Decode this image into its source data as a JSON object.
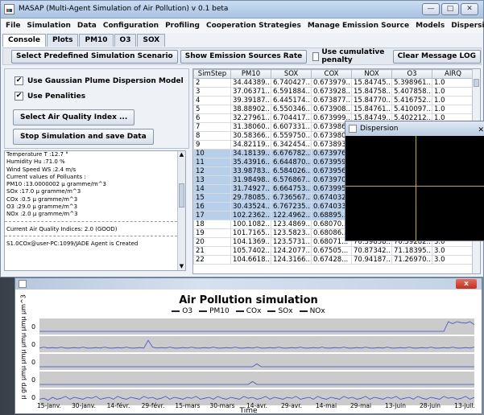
{
  "window": {
    "title": "MASAP (Multi-Agent Simulation of Air Pollution) v 0.1 beta",
    "controls": {
      "minimize": "—",
      "maximize": "□",
      "close": "✕"
    }
  },
  "menu": [
    "File",
    "Simulation",
    "Data",
    "Configuration",
    "Profiling",
    "Cooperation Strategies",
    "Manage Emission Source",
    "Models",
    "Dispersion",
    "?"
  ],
  "tabs": [
    "Console",
    "Plots",
    "PM10",
    "O3",
    "SOX"
  ],
  "toolbar": {
    "scenario_btn": "Select Predefined Simulation Scenario",
    "emission_btn": "Show Emission Sources Rate",
    "cumulative_label": "Use cumulative penalty",
    "clear_btn": "Clear Message LOG"
  },
  "left_panel": {
    "gaussian_label": "Use Gaussian Plume Dispersion Model",
    "penalties_label": "Use Penalities",
    "air_quality_btn": "Select Air Quality Index ...",
    "stop_btn": "Stop Simulation and save Data"
  },
  "log": [
    "            Temperature T   :12.7 °",
    "            Humidity Hu    :71.0 %",
    "            Wind Speed WS   :2.4 m/s",
    "Current values of Polluants :",
    "       PM10  :13.0000002  µ gramme/m^3",
    "       SOx   :17.0  µ gramme/m^3",
    "       COx   :0.5  µ gramme/m^3",
    "       O3    :29.0  µ gramme/m^3",
    "       NOx   :2.0  µ gramme/m^3",
    "",
    "Current Air Quality Indices: 2.0 (GOOD)",
    "",
    "S1.0COx@user-PC:1099/JADE Agent is Created"
  ],
  "table": {
    "headers": [
      "SimStep",
      "PM10",
      "SOX",
      "COX",
      "NOX",
      "O3",
      "AIRQ"
    ],
    "rows": [
      [
        "2",
        "34.44389...",
        "6.740427...",
        "0.673979...",
        "15.84745...",
        "5.398961...",
        "1.0"
      ],
      [
        "3",
        "37.06371...",
        "6.591884...",
        "0.673928...",
        "15.84758...",
        "5.407858...",
        "1.0"
      ],
      [
        "4",
        "39.39187...",
        "6.445174...",
        "0.673877...",
        "15.84770...",
        "5.416752...",
        "1.0"
      ],
      [
        "5",
        "38.88902...",
        "6.550346...",
        "0.673908...",
        "15.84761...",
        "5.410097...",
        "1.0"
      ],
      [
        "6",
        "32.27961...",
        "6.704417...",
        "0.673999...",
        "15.84749...",
        "5.402212...",
        "1.0"
      ],
      [
        "7",
        "31.38060...",
        "6.607331...",
        "0.673986...",
        "",
        "",
        ""
      ],
      [
        "8",
        "30.58366...",
        "6.559750...",
        "0.673980...",
        "",
        "",
        ""
      ],
      [
        "9",
        "34.82119...",
        "6.342454...",
        "0.673893...",
        "",
        "",
        ""
      ],
      [
        "10",
        "34.18139...",
        "6.676782...",
        "0.673976...",
        "",
        "",
        ""
      ],
      [
        "11",
        "35.43916...",
        "6.644870...",
        "0.673959...",
        "",
        "",
        ""
      ],
      [
        "12",
        "33.98783...",
        "6.584026...",
        "0.673956...",
        "",
        "",
        ""
      ],
      [
        "13",
        "31.98498...",
        "6.576867...",
        "0.673970...",
        "",
        "",
        ""
      ],
      [
        "14",
        "31.74927...",
        "6.664753...",
        "0.673995...",
        "",
        "",
        ""
      ],
      [
        "15",
        "29.78085...",
        "6.736567...",
        "0.674032...",
        "",
        "",
        ""
      ],
      [
        "16",
        "30.43524...",
        "6.767235...",
        "0.674033...",
        "",
        "",
        ""
      ],
      [
        "17",
        "102.2362...",
        "122.4962...",
        "0.68895...",
        "",
        "",
        ""
      ],
      [
        "18",
        "100.1082...",
        "123.4869...",
        "0.68070...",
        "",
        "",
        ""
      ],
      [
        "19",
        "101.7165...",
        "123.5823...",
        "0.68086...",
        "",
        "",
        ""
      ],
      [
        "20",
        "104.1369...",
        "123.5731...",
        "0.68071...",
        "70.39858...",
        "70.59282...",
        "3.0"
      ],
      [
        "21",
        "105.7402...",
        "124.2077...",
        "0.67505...",
        "70.87342...",
        "71.18395...",
        "3.0"
      ],
      [
        "22",
        "104.6618...",
        "124.3166...",
        "0.67428...",
        "70.94187...",
        "71.26970...",
        "3.0"
      ]
    ]
  },
  "dispersion": {
    "title": "Dispersion",
    "close": "✕"
  },
  "chart_window": {
    "close": "x"
  },
  "chart_data": {
    "type": "line",
    "title": "Air Pollution simulation",
    "legend": [
      "O3",
      "PM10",
      "COx",
      "SOx",
      "NOx"
    ],
    "ylabel": "µ grp µmµ µmµ µmµ µmµ µm^3",
    "xlabel": "Time",
    "x_ticks": [
      "15-janv.",
      "30-janv.",
      "14-févr.",
      "29-févr.",
      "15-mars",
      "30-mars",
      "14-avr.",
      "29-avr.",
      "14-mai",
      "29-mai",
      "13-juin",
      "28-juin",
      "13-juil."
    ],
    "zero_label": "0",
    "series": [
      {
        "name": "O3",
        "values": [
          0,
          0,
          0,
          0,
          0,
          0,
          0,
          0,
          0,
          0,
          0,
          0,
          0,
          0,
          0,
          0,
          0,
          0,
          0,
          0,
          0,
          0,
          0,
          0,
          0,
          0,
          0,
          0,
          0,
          0,
          0,
          0,
          0,
          0,
          0,
          0,
          0,
          0,
          0,
          0,
          0,
          0,
          0,
          0,
          0,
          0,
          0,
          0,
          0,
          0,
          0,
          0,
          0,
          0,
          0,
          0,
          0,
          0,
          0,
          0,
          0,
          0,
          0,
          0,
          0,
          0,
          0,
          0,
          0,
          0,
          0,
          0,
          0,
          0,
          0,
          0,
          0,
          0,
          0,
          0,
          0,
          0,
          0,
          0,
          0,
          0,
          0,
          0,
          0,
          0,
          0,
          0,
          0,
          0,
          1,
          0.8,
          1,
          0.9,
          0.85,
          1,
          0.7
        ]
      },
      {
        "name": "PM10",
        "values": [
          0.1,
          0.2,
          0.1,
          0.15,
          0.1,
          0.2,
          0.1,
          0.1,
          0.15,
          0.1,
          0.2,
          0.1,
          0.1,
          0.15,
          0.1,
          0.2,
          0.1,
          0.1,
          0.15,
          0.1,
          0.2,
          0.1,
          0.1,
          0.15,
          0.1,
          0.9,
          0.2,
          0.1,
          0.15,
          0.1,
          0.2,
          0.1,
          0.1,
          0.15,
          0.1,
          0.2,
          0.1,
          0.1,
          0.15,
          0.1,
          0.2,
          0.1,
          0.1,
          0.15,
          0.1,
          0.2,
          0.1,
          0.1,
          0.15,
          0.1,
          0.2,
          0.1,
          0.1,
          0.15,
          0.1,
          0.2,
          0.1,
          0.1,
          0.15,
          0.1,
          0.2,
          0.1,
          0.1,
          0.15,
          0.1,
          0.2,
          0.1,
          0.1,
          0.15,
          0.1,
          0.2,
          0.1,
          0.1,
          0.15,
          0.1,
          0.2,
          0.1,
          0.1,
          0.15,
          0.1,
          0.2,
          0.1,
          0.1,
          0.15,
          0.1,
          0.2,
          0.1,
          0.1,
          0.15,
          0.1,
          0.2,
          0.1,
          0.1,
          0.15,
          0.1,
          0.2,
          0.1,
          0.1,
          0.15,
          0.1,
          0.2
        ]
      },
      {
        "name": "COx",
        "values": [
          0,
          0,
          0,
          0,
          0,
          0,
          0,
          0,
          0,
          0,
          0,
          0,
          0,
          0,
          0,
          0,
          0,
          0,
          0,
          0,
          0,
          0,
          0,
          0,
          0,
          0,
          0,
          0,
          0,
          0,
          0,
          0,
          0,
          0,
          0,
          0,
          0,
          0,
          0,
          0,
          0,
          0,
          0,
          0,
          0,
          0,
          0,
          0,
          0,
          0,
          0.3,
          0,
          0,
          0,
          0,
          0,
          0,
          0,
          0,
          0,
          0,
          0,
          0,
          0,
          0,
          0,
          0,
          0,
          0,
          0,
          0,
          0,
          0,
          0,
          0,
          0,
          0,
          0,
          0,
          0,
          0,
          0,
          0,
          0,
          0,
          0,
          0,
          0,
          0,
          0,
          0,
          0,
          0,
          0,
          0,
          0,
          0,
          0,
          0,
          0,
          0
        ]
      },
      {
        "name": "SOx",
        "values": [
          0,
          0,
          0,
          0,
          0,
          0,
          0,
          0,
          0,
          0,
          0,
          0,
          0,
          0,
          0,
          0,
          0,
          0,
          0,
          0,
          0,
          0,
          0,
          0,
          0,
          0,
          0,
          0,
          0,
          0,
          0,
          0,
          0,
          0,
          0,
          0,
          0,
          0,
          0,
          0,
          0,
          0,
          0,
          0,
          0,
          0,
          0,
          0,
          0,
          0.3,
          0,
          0,
          0,
          0,
          0,
          0,
          0,
          0,
          0,
          0,
          0,
          0,
          0,
          0,
          0,
          0,
          0,
          0,
          0,
          0,
          0,
          0,
          0,
          0,
          0,
          0,
          0,
          0,
          0,
          0,
          0,
          0,
          0,
          0,
          0,
          0,
          0,
          0,
          0,
          0,
          0,
          0,
          0,
          0,
          0,
          0,
          0,
          0,
          0,
          0,
          0
        ]
      },
      {
        "name": "NOx",
        "values": [
          0.3,
          0.4,
          0.2,
          0.5,
          0.3,
          0.4,
          0.6,
          0.3,
          0.5,
          0.4,
          0.3,
          0.5,
          0.4,
          0.6,
          0.3,
          0.4,
          0.5,
          0.3,
          0.6,
          0.4,
          0.3,
          0.5,
          0.4,
          0.3,
          0.6,
          0.4,
          0.5,
          0.3,
          0.4,
          0.6,
          0.3,
          0.5,
          0.4,
          0.3,
          0.5,
          0.4,
          0.6,
          0.3,
          0.4,
          0.5,
          0.3,
          0.6,
          0.4,
          0.3,
          0.5,
          0.4,
          0.3,
          0.6,
          0.4,
          0.5,
          0.3,
          0.4,
          0.6,
          0.3,
          0.5,
          0.4,
          0.3,
          0.5,
          0.4,
          0.6,
          0.3,
          0.4,
          0.5,
          0.3,
          0.6,
          0.4,
          0.3,
          0.5,
          0.4,
          0.3,
          0.6,
          0.4,
          0.5,
          0.3,
          0.4,
          0.6,
          0.3,
          0.5,
          0.4,
          0.3,
          0.5,
          0.4,
          0.6,
          0.3,
          0.4,
          0.5,
          0.3,
          0.6,
          0.4,
          0.3,
          0.5,
          0.4,
          0.3,
          0.6,
          0.4,
          0.5,
          0.3,
          0.4,
          0.6,
          0.3,
          0.5
        ]
      }
    ],
    "ylim": [
      0,
      1
    ],
    "colors": {
      "line": "#3d4fd1",
      "panel": "#cbcbcb"
    }
  }
}
